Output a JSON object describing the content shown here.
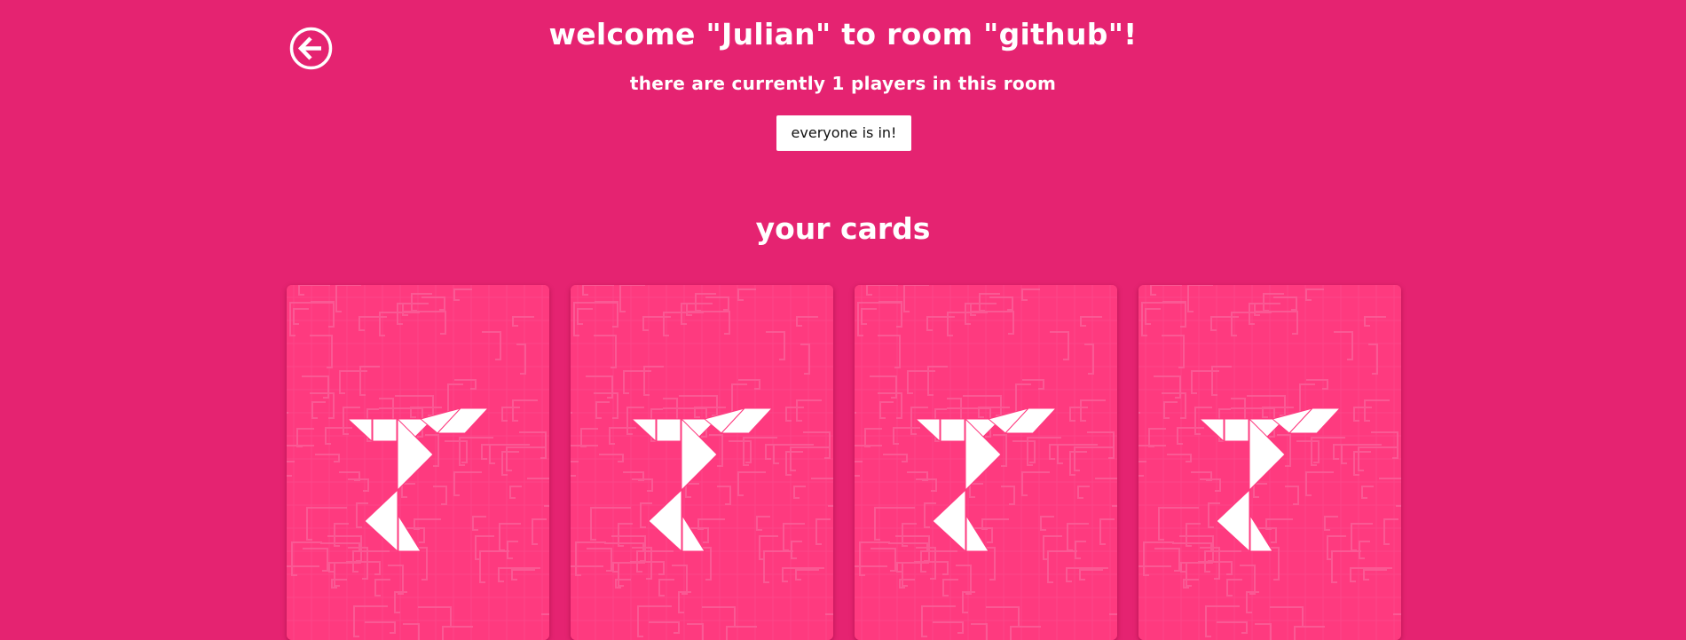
{
  "header": {
    "back_icon": "arrow-left-circle-icon",
    "title": "welcome \"Julian\" to room \"github\"!",
    "subtitle": "there are currently 1 players in this room",
    "ready_button_label": "everyone is in!"
  },
  "cards_section": {
    "title": "your cards",
    "cards": [
      {
        "face": "card-back",
        "logo_icon": "tangram-logo-icon"
      },
      {
        "face": "card-back",
        "logo_icon": "tangram-logo-icon"
      },
      {
        "face": "card-back",
        "logo_icon": "tangram-logo-icon"
      },
      {
        "face": "card-back",
        "logo_icon": "tangram-logo-icon"
      }
    ]
  },
  "colors": {
    "background": "#e52371",
    "card_back": "#fe3a7f",
    "circuit_lines": "#f9619a",
    "text": "#ffffff",
    "button_background": "#ffffff",
    "button_text": "#111111"
  }
}
